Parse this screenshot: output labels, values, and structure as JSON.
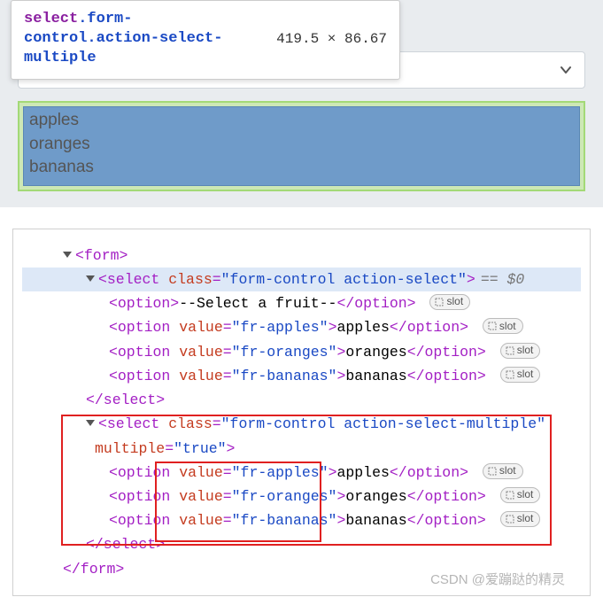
{
  "tooltip": {
    "tag": "select",
    "class1": ".form-control",
    "class2": ".action-select-multiple",
    "dims": "419.5 × 86.67"
  },
  "multi_options": [
    "apples",
    "oranges",
    "bananas"
  ],
  "dom": {
    "form_open": "<form>",
    "form_close": "</form>",
    "select1": {
      "open_tag": "select",
      "class_attr": "class",
      "class_val": "\"form-control action-select\"",
      "eq0": "== $0",
      "options": [
        {
          "prefix": "<option>",
          "text": "--Select a fruit--",
          "suffix": "</option>",
          "has_value": false
        },
        {
          "attr": "value",
          "val": "\"fr-apples\"",
          "text": "apples"
        },
        {
          "attr": "value",
          "val": "\"fr-oranges\"",
          "text": "oranges"
        },
        {
          "attr": "value",
          "val": "\"fr-bananas\"",
          "text": "bananas"
        }
      ],
      "close": "</select>"
    },
    "select2": {
      "open_tag": "select",
      "class_attr": "class",
      "class_val": "\"form-control action-select-multiple\"",
      "mult_attr": "multiple",
      "mult_val": "\"true\"",
      "options": [
        {
          "attr": "value",
          "val": "\"fr-apples\"",
          "text": "apples"
        },
        {
          "attr": "value",
          "val": "\"fr-oranges\"",
          "text": "oranges"
        },
        {
          "attr": "value",
          "val": "\"fr-bananas\"",
          "text": "bananas"
        }
      ],
      "close": "</select>"
    }
  },
  "slot_label": "slot",
  "watermark": "CSDN @爱蹦跶的精灵"
}
